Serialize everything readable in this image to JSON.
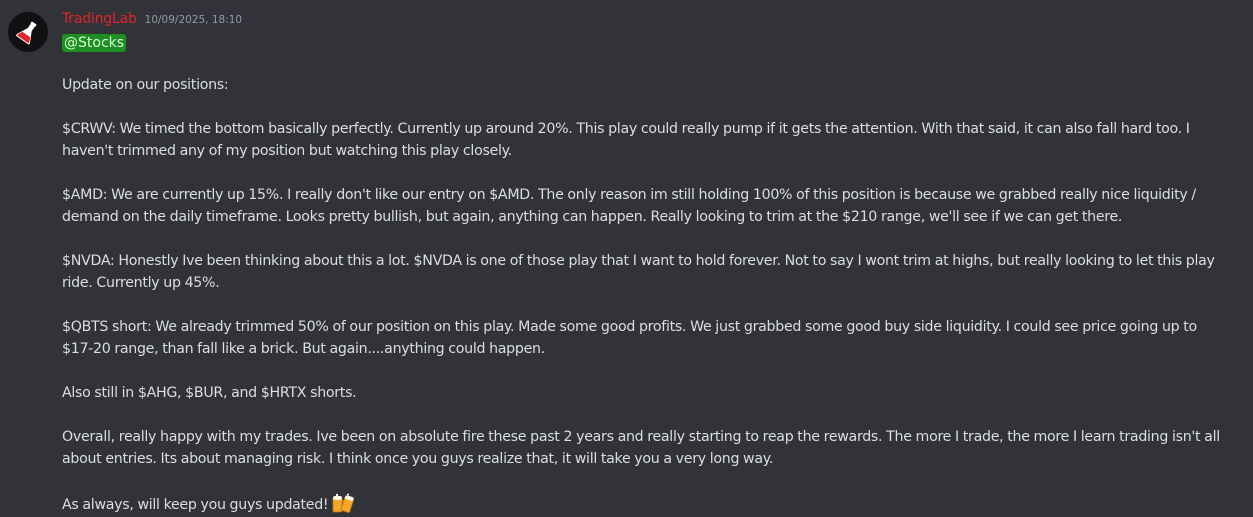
{
  "message": {
    "author": "TradingLab",
    "timestamp": "10/09/2025, 18:10",
    "author_color": "#e0252b",
    "mention": "@Stocks",
    "mention_bg": "#1d8e23",
    "paragraphs": [
      "Update on our positions:",
      "$CRWV: We timed the bottom basically perfectly. Currently up around 20%. This play could really pump if it gets the attention. With that said, it can also fall hard too. I haven't trimmed any of my position but watching this play closely.",
      "$AMD: We are currently up 15%. I really don't like our entry on $AMD. The only reason im still holding 100% of this position is because we grabbed really nice liquidity / demand on the daily timeframe. Looks pretty bullish, but again, anything can happen. Really looking to trim at the $210 range, we'll see if we can get there.",
      "$NVDA: Honestly Ive been thinking about this a lot. $NVDA is one of those play that I want to hold forever. Not to say I wont trim at highs, but really looking to let this play ride. Currently up 45%.",
      "$QBTS short: We already trimmed 50% of our position on this play. Made some good profits. We just grabbed some good buy side liquidity. I could see price going up to $17-20 range, than fall like a brick. But again....anything could happen.",
      "Also still in $AHG, $BUR, and $HRTX shorts.",
      "Overall, really happy with my trades. Ive been on absolute fire these past 2 years and really starting to reap the rewards. The more I trade, the more I learn trading isn't all about entries. Its about managing risk. I think once you guys realize that, it will take you a very long way.",
      "As always, will keep you guys updated!"
    ],
    "emoji": "beers-emoji",
    "avatar_icon": "flask-icon"
  }
}
